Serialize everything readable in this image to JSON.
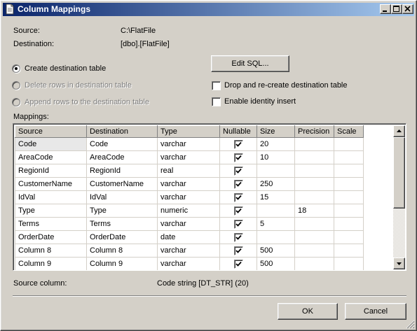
{
  "window": {
    "title": "Column Mappings"
  },
  "info": {
    "source_label": "Source:",
    "source_value": "C:\\FlatFile",
    "destination_label": "Destination:",
    "destination_value": "[dbo].[FlatFile]"
  },
  "options": {
    "create_table": "Create destination table",
    "delete_rows": "Delete rows in destination table",
    "append_rows": "Append rows to the destination table",
    "selected": "Create destination table",
    "edit_sql": "Edit SQL...",
    "drop_recreate": "Drop and re-create destination table",
    "drop_recreate_checked": false,
    "identity_insert": "Enable identity insert",
    "identity_insert_checked": false
  },
  "mappings": {
    "label": "Mappings:",
    "columns": [
      "Source",
      "Destination",
      "Type",
      "Nullable",
      "Size",
      "Precision",
      "Scale"
    ],
    "rows": [
      {
        "source": "Code",
        "destination": "Code",
        "type": "varchar",
        "nullable": true,
        "size": "20",
        "precision": "",
        "scale": ""
      },
      {
        "source": "AreaCode",
        "destination": "AreaCode",
        "type": "varchar",
        "nullable": true,
        "size": "10",
        "precision": "",
        "scale": ""
      },
      {
        "source": "RegionId",
        "destination": "RegionId",
        "type": "real",
        "nullable": true,
        "size": "",
        "precision": "",
        "scale": ""
      },
      {
        "source": "CustomerName",
        "destination": "CustomerName",
        "type": "varchar",
        "nullable": true,
        "size": "250",
        "precision": "",
        "scale": ""
      },
      {
        "source": "IdVal",
        "destination": "IdVal",
        "type": "varchar",
        "nullable": true,
        "size": "15",
        "precision": "",
        "scale": ""
      },
      {
        "source": "Type",
        "destination": "Type",
        "type": "numeric",
        "nullable": true,
        "size": "",
        "precision": "18",
        "scale": ""
      },
      {
        "source": "Terms",
        "destination": "Terms",
        "type": "varchar",
        "nullable": true,
        "size": "5",
        "precision": "",
        "scale": ""
      },
      {
        "source": "OrderDate",
        "destination": "OrderDate",
        "type": "date",
        "nullable": true,
        "size": "",
        "precision": "",
        "scale": ""
      },
      {
        "source": "Column 8",
        "destination": "Column 8",
        "type": "varchar",
        "nullable": true,
        "size": "500",
        "precision": "",
        "scale": ""
      },
      {
        "source": "Column 9",
        "destination": "Column 9",
        "type": "varchar",
        "nullable": true,
        "size": "500",
        "precision": "",
        "scale": ""
      }
    ]
  },
  "status": {
    "label": "Source column:",
    "value": "Code string [DT_STR] (20)"
  },
  "buttons": {
    "ok": "OK",
    "cancel": "Cancel"
  },
  "icons": {
    "app": "document-icon",
    "minimize": "minimize-icon",
    "maximize": "maximize-icon",
    "close": "close-icon",
    "scroll_up": "arrow-up-icon",
    "scroll_down": "arrow-down-icon",
    "nullable_check": "checkmark-icon",
    "resize": "resize-grip-icon"
  }
}
